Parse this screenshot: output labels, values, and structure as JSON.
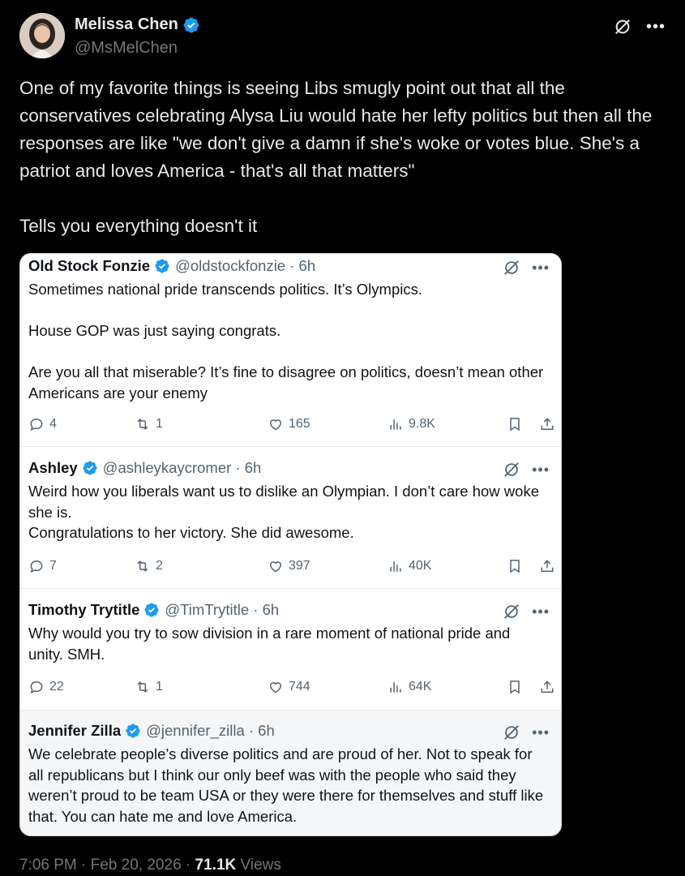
{
  "post": {
    "author_name": "Melissa Chen",
    "author_handle": "@MsMelChen",
    "text": "One of my favorite things is seeing Libs smugly point out that all the conservatives celebrating Alysa Liu would hate her lefty politics but then all the responses are like \"we don't give a damn if she's woke or votes blue. She's a patriot and loves America - that's all that matters\"\n\nTells you everything doesn't it",
    "time": "7:06 PM",
    "sep1": "·",
    "date": "Feb 20, 2026",
    "sep2": "·",
    "views": "71.1K",
    "views_label": "Views"
  },
  "replies": [
    {
      "name": "Old Stock Fonzie",
      "handle": "@oldstockfonzie · 6h",
      "text": "Sometimes national pride transcends politics.  It’s Olympics.\n\nHouse GOP was just saying congrats.\n\nAre you all that miserable?  It’s fine to disagree on politics, doesn’t mean other Americans are your enemy",
      "replies": "4",
      "retweets": "1",
      "likes": "165",
      "views": "9.8K"
    },
    {
      "name": "Ashley",
      "handle": "@ashleykaycromer · 6h",
      "text": "Weird how you liberals want us to dislike an Olympian.     I don’t care how woke she is.\nCongratulations to her victory. She did awesome.",
      "replies": "7",
      "retweets": "2",
      "likes": "397",
      "views": "40K"
    },
    {
      "name": "Timothy Trytitle",
      "handle": "@TimTrytitle · 6h",
      "text": "Why would you try to sow division in a rare moment of national pride and unity. SMH.",
      "replies": "22",
      "retweets": "1",
      "likes": "744",
      "views": "64K"
    },
    {
      "name": "Jennifer Zilla",
      "handle": "@jennifer_zilla · 6h",
      "text": "We celebrate people’s diverse politics and are proud of her. Not to speak for all republicans but I think our only beef was with the people who said they weren’t proud to be team USA or they were there for themselves and stuff like that. You can hate me and love America."
    }
  ],
  "icons": {
    "verified": "verified-badge-icon",
    "grok": "grok-icon",
    "more": "more-icon",
    "reply": "reply-icon",
    "retweet": "retweet-icon",
    "like": "heart-icon",
    "views": "views-icon",
    "bookmark": "bookmark-icon",
    "share": "share-icon"
  },
  "colors": {
    "background": "#000000",
    "verified": "#1d9bf0",
    "muted_text": "#71767b",
    "embed_bg": "#ffffff"
  }
}
